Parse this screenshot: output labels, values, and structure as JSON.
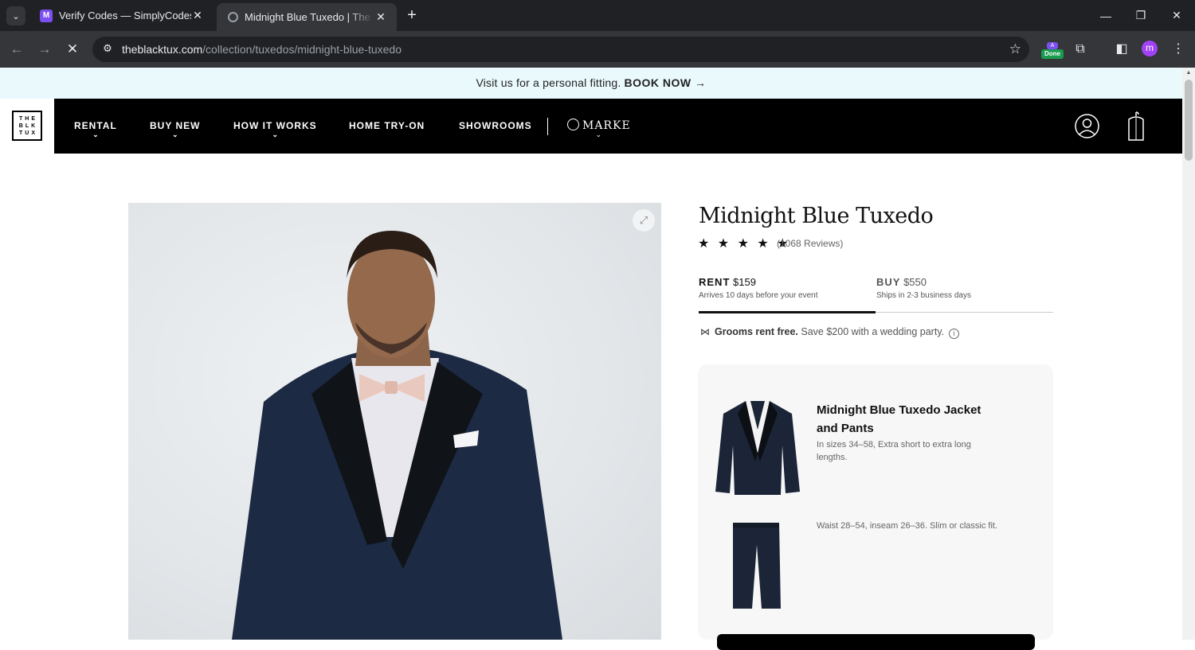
{
  "browser": {
    "tabs": [
      {
        "title": "Verify Codes — SimplyCodes",
        "favicon": "simplycodes-icon"
      },
      {
        "title": "Midnight Blue Tuxedo | The Black Tux",
        "favicon": "loading-icon"
      }
    ],
    "url_host": "theblacktux.com",
    "url_path": "/collection/tuxedos/midnight-blue-tuxedo",
    "extension_badge_top": "A",
    "extension_badge": "Done",
    "profile_initial": "m"
  },
  "promo": {
    "text": "Visit us for a personal fitting.",
    "cta": "BOOK NOW →"
  },
  "nav": {
    "logo_lines": [
      "THE",
      "BLK",
      "TUX"
    ],
    "items": [
      {
        "label": "RENTAL",
        "has_dropdown": true
      },
      {
        "label": "BUY NEW",
        "has_dropdown": true
      },
      {
        "label": "HOW IT WORKS",
        "has_dropdown": true
      },
      {
        "label": "HOME TRY-ON",
        "has_dropdown": false
      },
      {
        "label": "SHOWROOMS",
        "has_dropdown": false
      }
    ],
    "marke": "MARKE"
  },
  "product": {
    "title": "Midnight Blue Tuxedo",
    "stars": "★ ★ ★ ★ ★",
    "rating": 5,
    "reviews": "(1068 Reviews)",
    "options": [
      {
        "label": "RENT",
        "price": "$159",
        "sub": "Arrives 10 days before your event",
        "selected": true
      },
      {
        "label": "BUY",
        "price": "$550",
        "sub": "Ships in 2-3 business days",
        "selected": false
      }
    ],
    "grooms_bold": "Grooms rent free.",
    "grooms_text": "Save $200 with a wedding party.",
    "items": [
      {
        "title": "Midnight Blue Tuxedo Jacket and Pants",
        "desc": "In sizes 34–58, Extra short to extra long lengths."
      },
      {
        "title": "",
        "desc": "Waist 28–54, inseam 26–36. Slim or classic fit."
      }
    ]
  },
  "colors": {
    "promo_bg": "#eaf9fc",
    "nav_bg": "#000000",
    "chrome_dark": "#202124",
    "chrome_mid": "#35363a",
    "tuxedo_navy": "#1c2a44"
  }
}
